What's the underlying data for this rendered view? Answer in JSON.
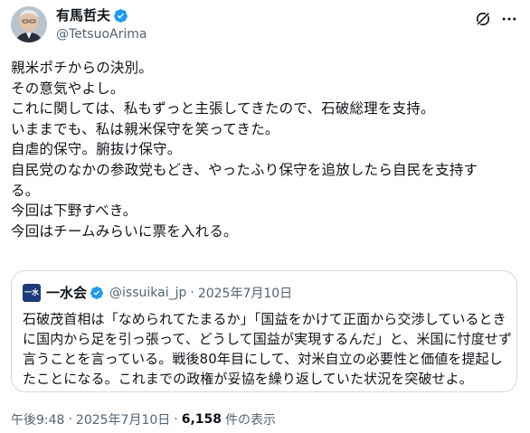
{
  "author": {
    "display_name": "有馬哲夫",
    "handle": "@TetsuoArima",
    "verified": true
  },
  "icons": {
    "verified": "verified-badge-icon",
    "grok": "grok-icon",
    "more": "more-icon"
  },
  "tweet": {
    "lines": [
      "親米ポチからの決別。",
      "その意気やよし。",
      "これに関しては、私もずっと主張してきたので、石破総理を支持。",
      "いままでも、私は親米保守を笑ってきた。",
      "自虐的保守。腑抜け保守。",
      "自民党のなかの参政党もどき、やったふり保守を追放したら自民を支持す",
      "る。",
      "今回は下野すべき。",
      "今回はチームみらいに票を入れる。"
    ]
  },
  "quote": {
    "logo_text": "一水",
    "name": "一水会",
    "verified": true,
    "handle": "@issuikai_jp",
    "dot": "·",
    "date": "2025年7月10日",
    "lines": [
      "石破茂首相は「なめられてたまるか」「国益をかけて正面から交渉しているとき",
      "に国内から足を引っ張って、どうして国益が実現するんだ」と、米国に忖度せず",
      "言うことを言っている。戦後80年目にして、対米自立の必要性と価値を提起し",
      "たことになる。これまでの政権が妥協を繰り返していた状況を突破せよ。"
    ]
  },
  "footer": {
    "time": "午後9:48",
    "sep": "·",
    "date": "2025年7月10日",
    "views": "6,158",
    "views_label": "件の表示"
  },
  "colors": {
    "text": "#0f1419",
    "secondary": "#536471",
    "verified_blue": "#1d9bf0",
    "border": "#cfd9de"
  }
}
